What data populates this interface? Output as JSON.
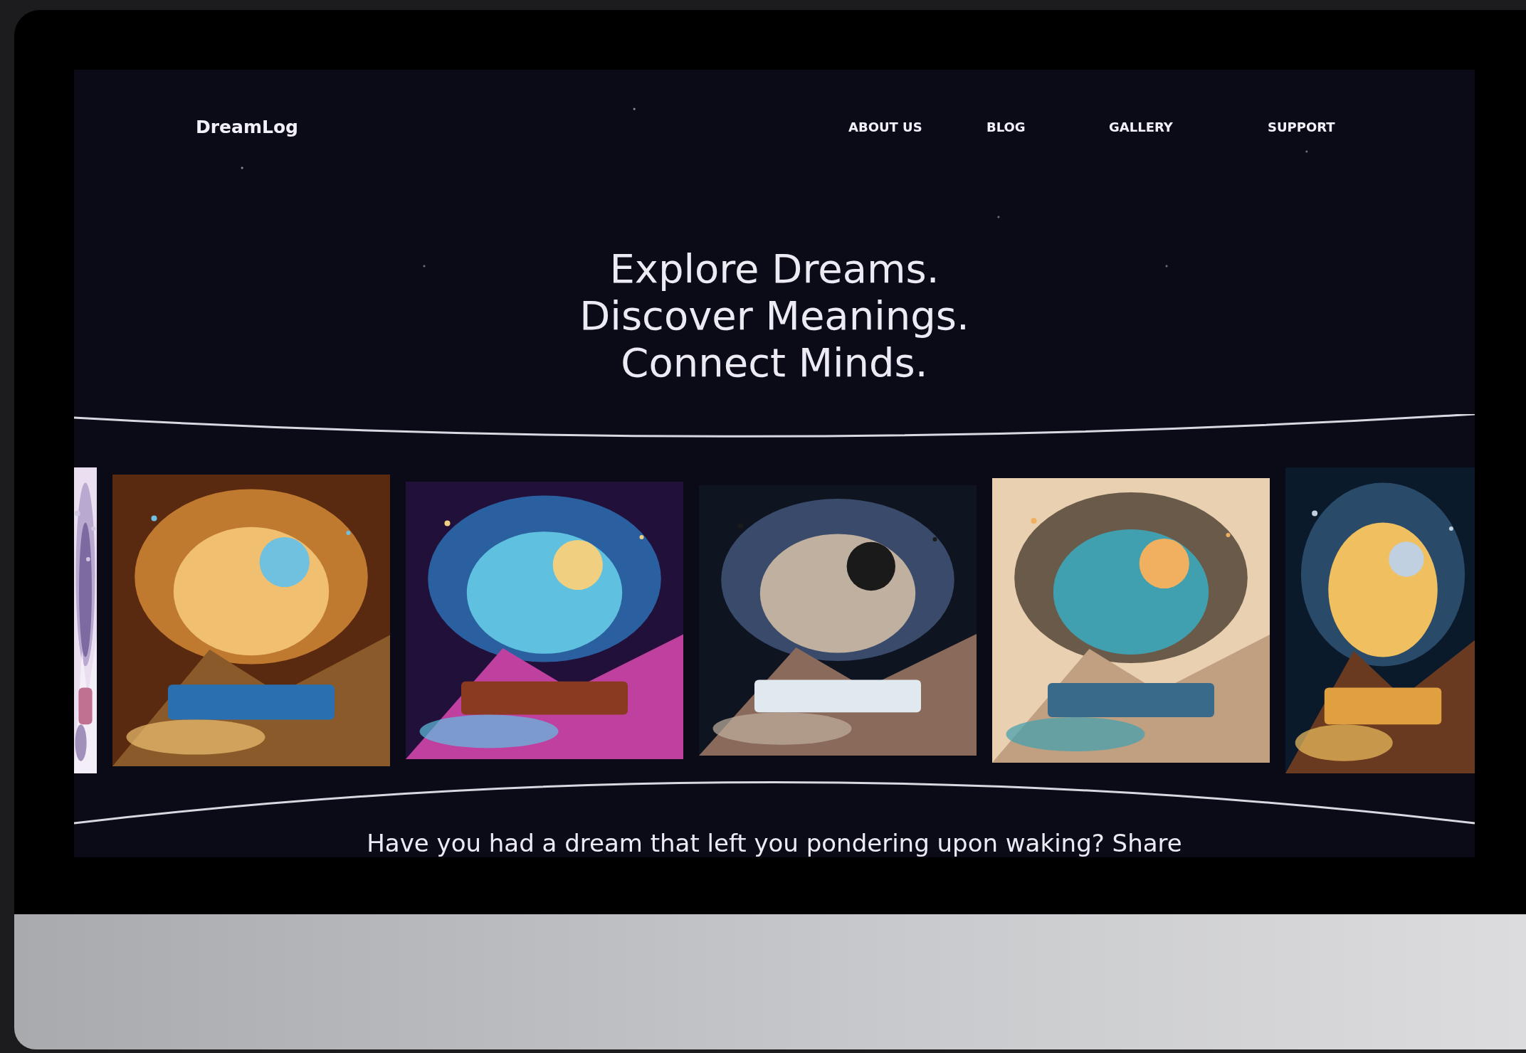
{
  "site": {
    "logo": "DreamLog"
  },
  "nav": [
    {
      "label": "ABOUT US"
    },
    {
      "label": "BLOG"
    },
    {
      "label": "GALLERY"
    },
    {
      "label": "SUPPORT"
    }
  ],
  "hero": {
    "lines": [
      "Explore Dreams.",
      "Discover Meanings.",
      "Connect Minds."
    ]
  },
  "intro": "Have you had a dream that left you pondering upon waking? Share"
}
